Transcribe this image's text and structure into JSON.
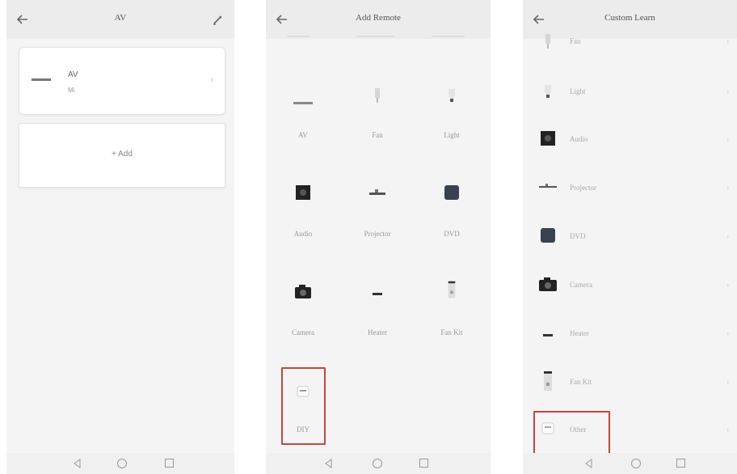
{
  "screen1": {
    "title": "AV",
    "device_card": {
      "name": "AV",
      "subtitle": "Mi"
    },
    "add_button": {
      "label": "+ Add"
    }
  },
  "screen2": {
    "title": "Add Remote",
    "items": [
      {
        "label": "AV",
        "icon": "av-dash-icon"
      },
      {
        "label": "Fan",
        "icon": "fan-icon"
      },
      {
        "label": "Light",
        "icon": "light-bulb-icon"
      },
      {
        "label": "Audio",
        "icon": "audio-speaker-icon"
      },
      {
        "label": "Projector",
        "icon": "projector-icon"
      },
      {
        "label": "DVD",
        "icon": "dvd-player-icon"
      },
      {
        "label": "Camera",
        "icon": "camera-icon"
      },
      {
        "label": "Heater",
        "icon": "heater-icon"
      },
      {
        "label": "Fan Kit",
        "icon": "fan-kit-remote-icon"
      },
      {
        "label": "DIY",
        "icon": "diy-icon"
      }
    ]
  },
  "screen3": {
    "title": "Custom Learn",
    "items": [
      {
        "label": "Fan",
        "icon": "fan-icon"
      },
      {
        "label": "Light",
        "icon": "light-bulb-icon"
      },
      {
        "label": "Audio",
        "icon": "audio-speaker-icon"
      },
      {
        "label": "Projector",
        "icon": "projector-icon"
      },
      {
        "label": "DVD",
        "icon": "dvd-player-icon"
      },
      {
        "label": "Camera",
        "icon": "camera-icon"
      },
      {
        "label": "Heater",
        "icon": "heater-icon"
      },
      {
        "label": "Fan Kit",
        "icon": "fan-kit-remote-icon"
      },
      {
        "label": "Other",
        "icon": "other-device-icon"
      }
    ]
  },
  "colors": {
    "highlight": "#c8453f",
    "background": "#f4f4f4"
  }
}
